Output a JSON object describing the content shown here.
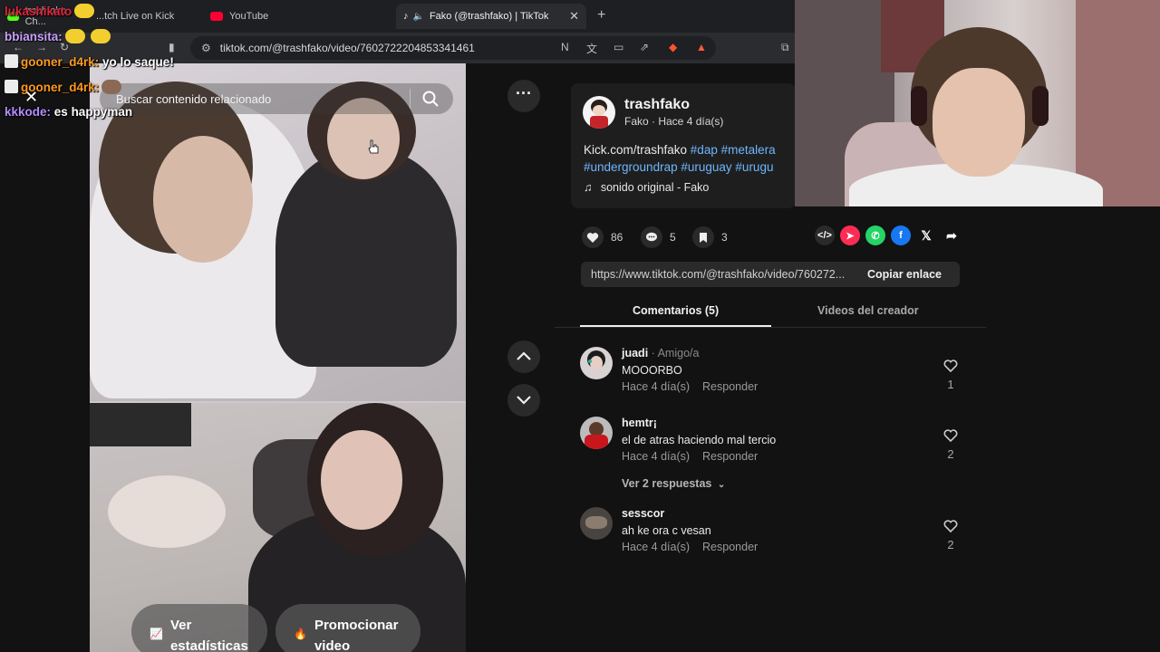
{
  "browser": {
    "tabs": [
      {
        "label": "trashfako Ch...",
        "favicon_color": "#53fc18"
      },
      {
        "label": "...tch Live on Kick",
        "favicon_color": "#53fc18"
      },
      {
        "label": "YouTube",
        "favicon_color": "#ff0033"
      },
      {
        "label": "Fako (@trashfako) | TikTok",
        "favicon_color": "#ffffff"
      }
    ],
    "url": "tiktok.com/@trashfako/video/7602722204853341461"
  },
  "video": {
    "search_placeholder": "Buscar contenido relacionado",
    "stats_button": [
      "Ver",
      "estadísticas"
    ],
    "promote_button": [
      "Promocionar",
      "video"
    ]
  },
  "author": {
    "username": "trashfako",
    "subtitle": "Fako · Hace 4 día(s)"
  },
  "description": {
    "line1_text": "Kick.com/trashfako ",
    "line1_tags": [
      "#dap",
      "#metalera"
    ],
    "line2_tags": [
      "#undergroundrap",
      "#uruguay",
      "#urugu"
    ]
  },
  "music": "sonido original - Fako",
  "stats": {
    "likes": "86",
    "comments": "5",
    "saves": "3"
  },
  "share_icons": [
    "embed-icon",
    "send-to-friend-icon",
    "whatsapp-icon",
    "facebook-icon",
    "x-icon",
    "share-arrow-icon"
  ],
  "link": {
    "url": "https://www.tiktok.com/@trashfako/video/760272...",
    "copy_label": "Copiar enlace"
  },
  "comment_tabs": {
    "comments": "Comentarios (5)",
    "creator_videos": "Videos del creador"
  },
  "comments": [
    {
      "user": "juadi",
      "relation": " · Amigo/a",
      "text": "MOOORBO",
      "time": "Hace 4 día(s)",
      "reply": "Responder",
      "likes": "1"
    },
    {
      "user": "hemtr¡",
      "relation": "",
      "text": "el de atras haciendo mal tercio",
      "time": "Hace 4 día(s)",
      "reply": "Responder",
      "likes": "2"
    },
    {
      "user": "sesscor",
      "relation": "",
      "text": "ah ke ora c vesan",
      "time": "Hace 4 día(s)",
      "reply": "Responder",
      "likes": "2"
    }
  ],
  "view_replies": "Ver 2 respuestas",
  "chat": [
    {
      "user": "lukashikato",
      "user_color": "#e0233d",
      "message": ""
    },
    {
      "user": "bbiansita:",
      "user_color": "#c9a0ff",
      "message": ""
    },
    {
      "user": "gooner_d4rk:",
      "user_color": "#ff9a1f",
      "message": "yo lo saque!"
    },
    {
      "user": "gooner_d4rk:",
      "user_color": "#ff9a1f",
      "message": ""
    },
    {
      "user": "kkkode:",
      "user_color": "#b48cff",
      "message": "es happyman"
    }
  ],
  "colors": {
    "accent_link": "#6fb6ff",
    "background": "#121212",
    "card": "#1e1e1e"
  }
}
